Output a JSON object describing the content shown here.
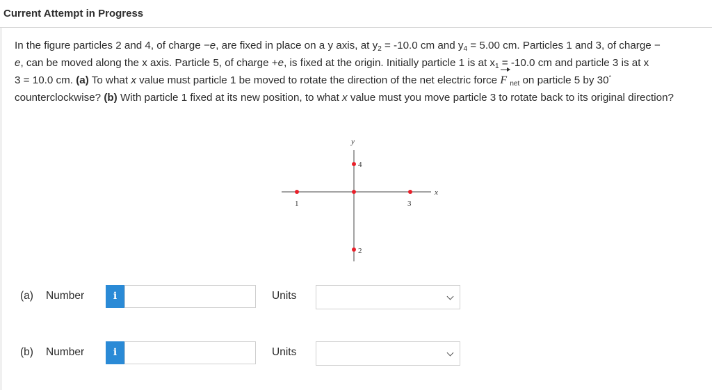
{
  "header": {
    "title": "Current Attempt in Progress"
  },
  "question": {
    "p1": "In the figure particles 2 and 4, of charge ",
    "neg_e_1": "−e",
    "p2": ", are fixed in place on a y axis, at y",
    "y2_sub": "2",
    "p3": " = -10.0 cm and y",
    "y4_sub": "4",
    "p4": " = 5.00 cm. Particles 1 and 3, of charge −",
    "e_1": "e",
    "p5": ", can be moved along the x axis. Particle 5, of charge +",
    "e_2": "e",
    "p6": ", is fixed at the origin. Initially particle 1 is at x",
    "x1_sub": "1",
    "p7": " = -10.0 cm and particle 3 is at x",
    "x3_sub": "3",
    "p8": " = 10.0 cm. ",
    "part_a_tag": "(a)",
    "p9": " To what ",
    "x_var_1": "x",
    "p10": " value must particle 1 be moved to rotate the direction of the net electric force ",
    "force_symbol": "F",
    "force_sub": "net",
    "p11": " on particle 5 by 30",
    "degree": "°",
    "p12": " counterclockwise? ",
    "part_b_tag": "(b)",
    "p13": " With particle 1 fixed at its new position, to what ",
    "x_var_2": "x",
    "p14": " value must you move particle 3 to rotate back to its original direction?"
  },
  "figure": {
    "y_axis_label": "y",
    "x_axis_label": "x",
    "particles": [
      {
        "label": "1"
      },
      {
        "label": "2"
      },
      {
        "label": "3"
      },
      {
        "label": "4"
      }
    ],
    "particle_color": "#e8202a"
  },
  "answers": [
    {
      "part": "(a)",
      "number_label": "Number",
      "info_icon": "i",
      "value": "",
      "units_label": "Units",
      "units_value": ""
    },
    {
      "part": "(b)",
      "number_label": "Number",
      "info_icon": "i",
      "value": "",
      "units_label": "Units",
      "units_value": ""
    }
  ],
  "colors": {
    "info_button": "#2a8ad6",
    "particle": "#e8202a"
  }
}
